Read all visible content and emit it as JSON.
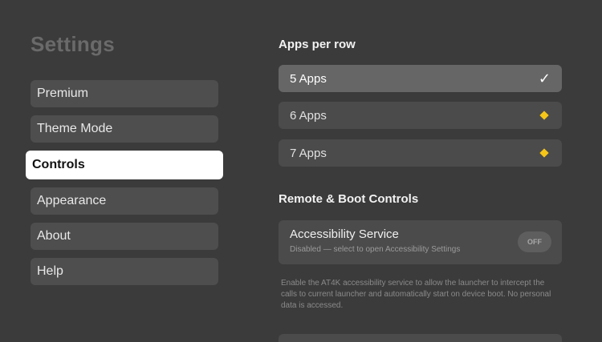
{
  "page": {
    "title": "Settings"
  },
  "sidebar": {
    "items": [
      {
        "label": "Premium"
      },
      {
        "label": "Theme Mode"
      },
      {
        "label": "Controls"
      },
      {
        "label": "Appearance"
      },
      {
        "label": "About"
      },
      {
        "label": "Help"
      }
    ],
    "selected": "Controls"
  },
  "apps_per_row": {
    "title": "Apps per row",
    "options": [
      {
        "label": "5 Apps",
        "selected": true,
        "icon": "check-icon"
      },
      {
        "label": "6 Apps",
        "selected": false,
        "icon": "premium-diamond-icon"
      },
      {
        "label": "7 Apps",
        "selected": false,
        "icon": "premium-diamond-icon"
      }
    ]
  },
  "remote_boot": {
    "title": "Remote & Boot Controls",
    "accessibility": {
      "title": "Accessibility Service",
      "subtitle": "Disabled — select to open Accessibility Settings",
      "toggle": "OFF"
    },
    "description": "Enable the AT4K accessibility service to allow the launcher to intercept the calls to current launcher and automatically start on device boot. No personal data is accessed."
  },
  "colors": {
    "premium_diamond": "#f5c518",
    "selected_item": "#ffffff"
  }
}
